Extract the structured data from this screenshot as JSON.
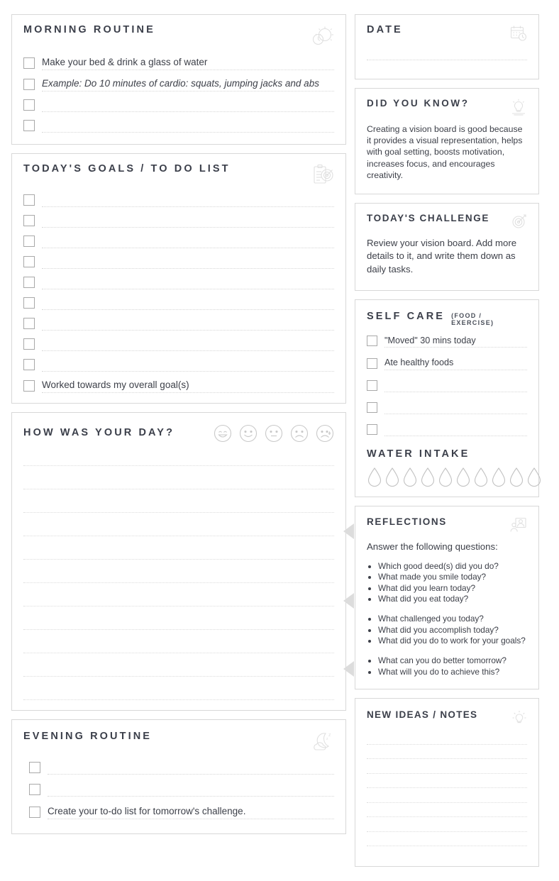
{
  "left": {
    "morning": {
      "title": "MORNING ROUTINE",
      "icon": "alarm-clock-sun-icon",
      "items": [
        {
          "label": "Make your bed & drink a glass of water",
          "italic": false
        },
        {
          "label": "Example: Do 10 minutes of cardio: squats, jumping jacks and abs",
          "italic": true
        },
        {
          "label": "",
          "italic": false
        },
        {
          "label": "",
          "italic": false
        }
      ]
    },
    "goals": {
      "title": "TODAY'S GOALS / TO DO LIST",
      "icon": "clipboard-target-icon",
      "items": [
        {
          "label": ""
        },
        {
          "label": ""
        },
        {
          "label": ""
        },
        {
          "label": ""
        },
        {
          "label": ""
        },
        {
          "label": ""
        },
        {
          "label": ""
        },
        {
          "label": ""
        },
        {
          "label": ""
        },
        {
          "label": "Worked towards my overall goal(s)"
        }
      ]
    },
    "day": {
      "title": "HOW WAS YOUR DAY?",
      "moods": [
        "mood-very-happy-icon",
        "mood-happy-icon",
        "mood-neutral-icon",
        "mood-sad-icon",
        "mood-crying-icon"
      ],
      "line_count": 11
    },
    "evening": {
      "title": "EVENING ROUTINE",
      "icon": "moon-cloud-sleep-icon",
      "items": [
        {
          "label": ""
        },
        {
          "label": ""
        },
        {
          "label": "Create your to-do list for tomorrow's challenge."
        }
      ]
    }
  },
  "right": {
    "date": {
      "title": "DATE",
      "icon": "calendar-clock-icon",
      "value": ""
    },
    "did_you_know": {
      "title": "DID YOU KNOW?",
      "icon": "lightbulb-idea-icon",
      "text": "Creating a vision board is good because it provides a visual representation, helps with goal setting, boosts motivation, increases focus, and encourages creativity."
    },
    "challenge": {
      "title": "TODAY'S CHALLENGE",
      "icon": "target-dart-icon",
      "text": "Review your vision board. Add more details to it, and write them down as daily tasks."
    },
    "self_care": {
      "title": "SELF CARE",
      "subtitle": "(FOOD / EXERCISE)",
      "items": [
        {
          "label": "\"Moved\" 30 mins today"
        },
        {
          "label": "Ate healthy foods"
        },
        {
          "label": ""
        },
        {
          "label": ""
        },
        {
          "label": ""
        }
      ],
      "water": {
        "title": "WATER INTAKE",
        "drop_count": 10
      }
    },
    "reflections": {
      "title": "REFLECTIONS",
      "icon": "people-frame-icon",
      "intro": "Answer the following questions:",
      "groups": [
        [
          "Which good deed(s) did you do?",
          "What made you smile today?",
          "What did you learn today?",
          "What did you eat today?"
        ],
        [
          "What challenged you today?",
          "What did you accomplish today?",
          "What did you do to work for your goals?"
        ],
        [
          "What can you do better tomorrow?",
          "What will you do to achieve this?"
        ]
      ]
    },
    "notes": {
      "title": "NEW IDEAS / NOTES",
      "icon": "lightbulb-icon",
      "line_count": 8
    }
  },
  "colors": {
    "heading": "#3b3f4a",
    "body": "#3d4049",
    "border": "#d8d8d8",
    "rule": "#d6d6d6",
    "icon": "#bdbdbd",
    "arrow": "#dcdcdc"
  }
}
